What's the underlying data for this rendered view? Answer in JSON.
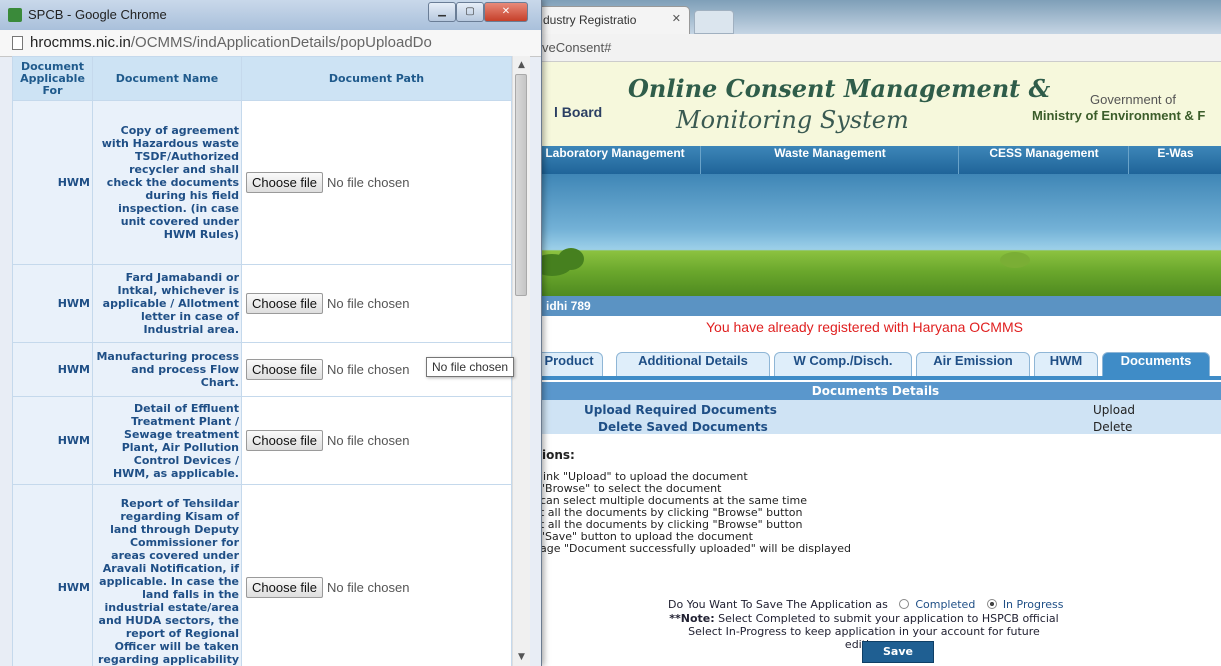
{
  "background_page": {
    "tab_title": "dustry Registratio",
    "address_suffix": "veConsent#",
    "header": {
      "title_line1": "Online Consent Management &",
      "title_line2": "Monitoring System",
      "board_label": "l Board",
      "gov_label": "Government of",
      "ministry_label": "Ministry of Environment & F"
    },
    "nav": [
      "Laboratory Management",
      "Waste Management",
      "CESS Management",
      "E-Was"
    ],
    "user_label": "idhi 789",
    "registered_message": "You have already registered with Haryana OCMMS",
    "tabs": [
      {
        "label": "Product",
        "active": false
      },
      {
        "label": "Additional Details",
        "active": false
      },
      {
        "label": "W Comp./Disch.",
        "active": false
      },
      {
        "label": "Air Emission",
        "active": false
      },
      {
        "label": "HWM",
        "active": false
      },
      {
        "label": "Documents",
        "active": true
      }
    ],
    "documents_details": {
      "heading": "Documents Details",
      "rows": [
        {
          "label": "Upload Required Documents",
          "action": "Upload"
        },
        {
          "label": "Delete Saved Documents",
          "action": "Delete"
        }
      ]
    },
    "instructions_title": "ions:",
    "instructions": [
      "link \"Upload\" to upload the document",
      "\"Browse\" to select the document",
      "can select multiple documents at the same time",
      "t all the documents by clicking \"Browse\" button",
      "t all the documents by clicking \"Browse\" button",
      "\"Save\" button to upload the document",
      "age \"Document successfully uploaded\" will be displayed"
    ],
    "save_question": "Do You Want To Save The Application as",
    "radio_options": [
      {
        "label": "Completed",
        "selected": false
      },
      {
        "label": "In Progress",
        "selected": true
      }
    ],
    "note_bold": "**Note:",
    "note_line1": "Select Completed to submit your application to HSPCB official",
    "note_line2": "Select In-Progress to keep application in your account for future editing",
    "save_label": "Save"
  },
  "popup": {
    "window_title": "SPCB - Google Chrome",
    "url_host": "hrocmms.nic.in",
    "url_path": "/OCMMS/indApplicationDetails/popUploadDo",
    "columns": [
      "Document Applicable For",
      "Document Name",
      "Document Path"
    ],
    "choose_label": "Choose file",
    "no_file_label": "No file chosen",
    "tooltip": "No file chosen",
    "rows": [
      {
        "applicable": "HWM",
        "name": "Copy of agreement with Hazardous waste TSDF/Authorized recycler and shall check the documents during his field inspection. (in case unit covered under HWM Rules)"
      },
      {
        "applicable": "HWM",
        "name": "Fard Jamabandi or Intkal, whichever is applicable / Allotment letter in case of Industrial area."
      },
      {
        "applicable": "HWM",
        "name": "Manufacturing process and process Flow Chart."
      },
      {
        "applicable": "HWM",
        "name": "Detail of Effluent Treatment Plant / Sewage treatment Plant, Air Pollution Control Devices / HWM, as applicable."
      },
      {
        "applicable": "HWM",
        "name": "Report of Tehsildar regarding Kisam of land through Deputy Commissioner for areas covered under Aravali Notification, if applicable. In case the land falls in the industrial estate/area and HUDA sectors, the report of Regional Officer will be taken regarding applicability of"
      }
    ]
  }
}
